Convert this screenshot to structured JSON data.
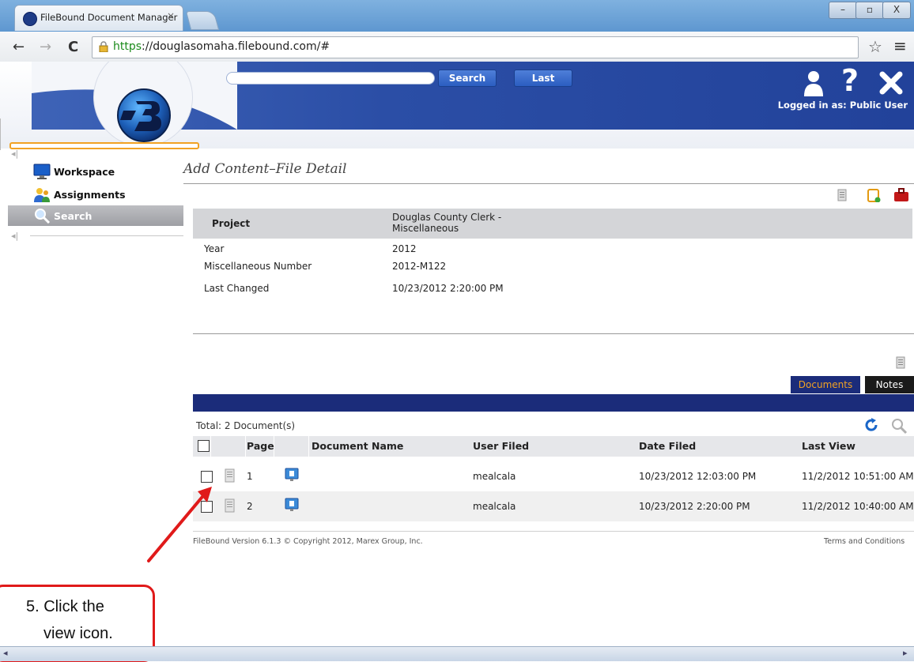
{
  "browser": {
    "tab_title": "FileBound Document Manager",
    "tab_close": "×",
    "url_scheme": "https",
    "url_rest": "://douglasomaha.filebound.com/#",
    "back": "←",
    "forward": "→",
    "reload": "C",
    "star": "☆",
    "menu": "≡",
    "win_min": "–",
    "win_max": "▫",
    "win_close": "X"
  },
  "header": {
    "search_label": "Search",
    "last_label": "Last",
    "logged_in": "Logged in as: Public User",
    "icons": [
      "user-icon",
      "help-icon",
      "close-icon"
    ]
  },
  "sidebar": {
    "items": [
      {
        "label": "Workspace",
        "icon": "monitor-icon"
      },
      {
        "label": "Assignments",
        "icon": "people-icon"
      },
      {
        "label": "Search",
        "icon": "magnifier-icon",
        "selected": true
      }
    ]
  },
  "main": {
    "title": "Add Content–File Detail",
    "details": [
      {
        "label": "Project",
        "value": "Douglas County Clerk - Miscellaneous",
        "value_line1": "Douglas County Clerk -",
        "value_line2": "Miscellaneous"
      },
      {
        "label": "Year",
        "value": "2012"
      },
      {
        "label": "Miscellaneous Number",
        "value": "2012-M122"
      },
      {
        "label": "Last Changed",
        "value": "10/23/2012 2:20:00 PM"
      }
    ],
    "tabs": [
      {
        "label": "Documents",
        "active": true
      },
      {
        "label": "Notes",
        "active": false
      }
    ],
    "total": "Total: 2 Document(s)",
    "columns": [
      "Page",
      "Document Name",
      "User Filed",
      "Date Filed",
      "Last View"
    ],
    "rows": [
      {
        "page": "1",
        "name": "",
        "user": "mealcala",
        "date_filed": "10/23/2012 12:03:00 PM",
        "last_view": "11/2/2012 10:51:00 AM"
      },
      {
        "page": "2",
        "name": "",
        "user": "mealcala",
        "date_filed": "10/23/2012 2:20:00 PM",
        "last_view": "11/2/2012 10:40:00 AM"
      }
    ]
  },
  "footer": {
    "version": "FileBound Version 6.1.3 © Copyright 2012, Marex Group, Inc.",
    "terms": "Terms and Conditions"
  },
  "callout": {
    "line1": "5. Click the",
    "line2": "view icon."
  },
  "colors": {
    "header_blue": "#2b4ea6",
    "grid_bar": "#1b2c7a",
    "callout_red": "#e01a1a",
    "tab_active_text": "#f1a224"
  }
}
